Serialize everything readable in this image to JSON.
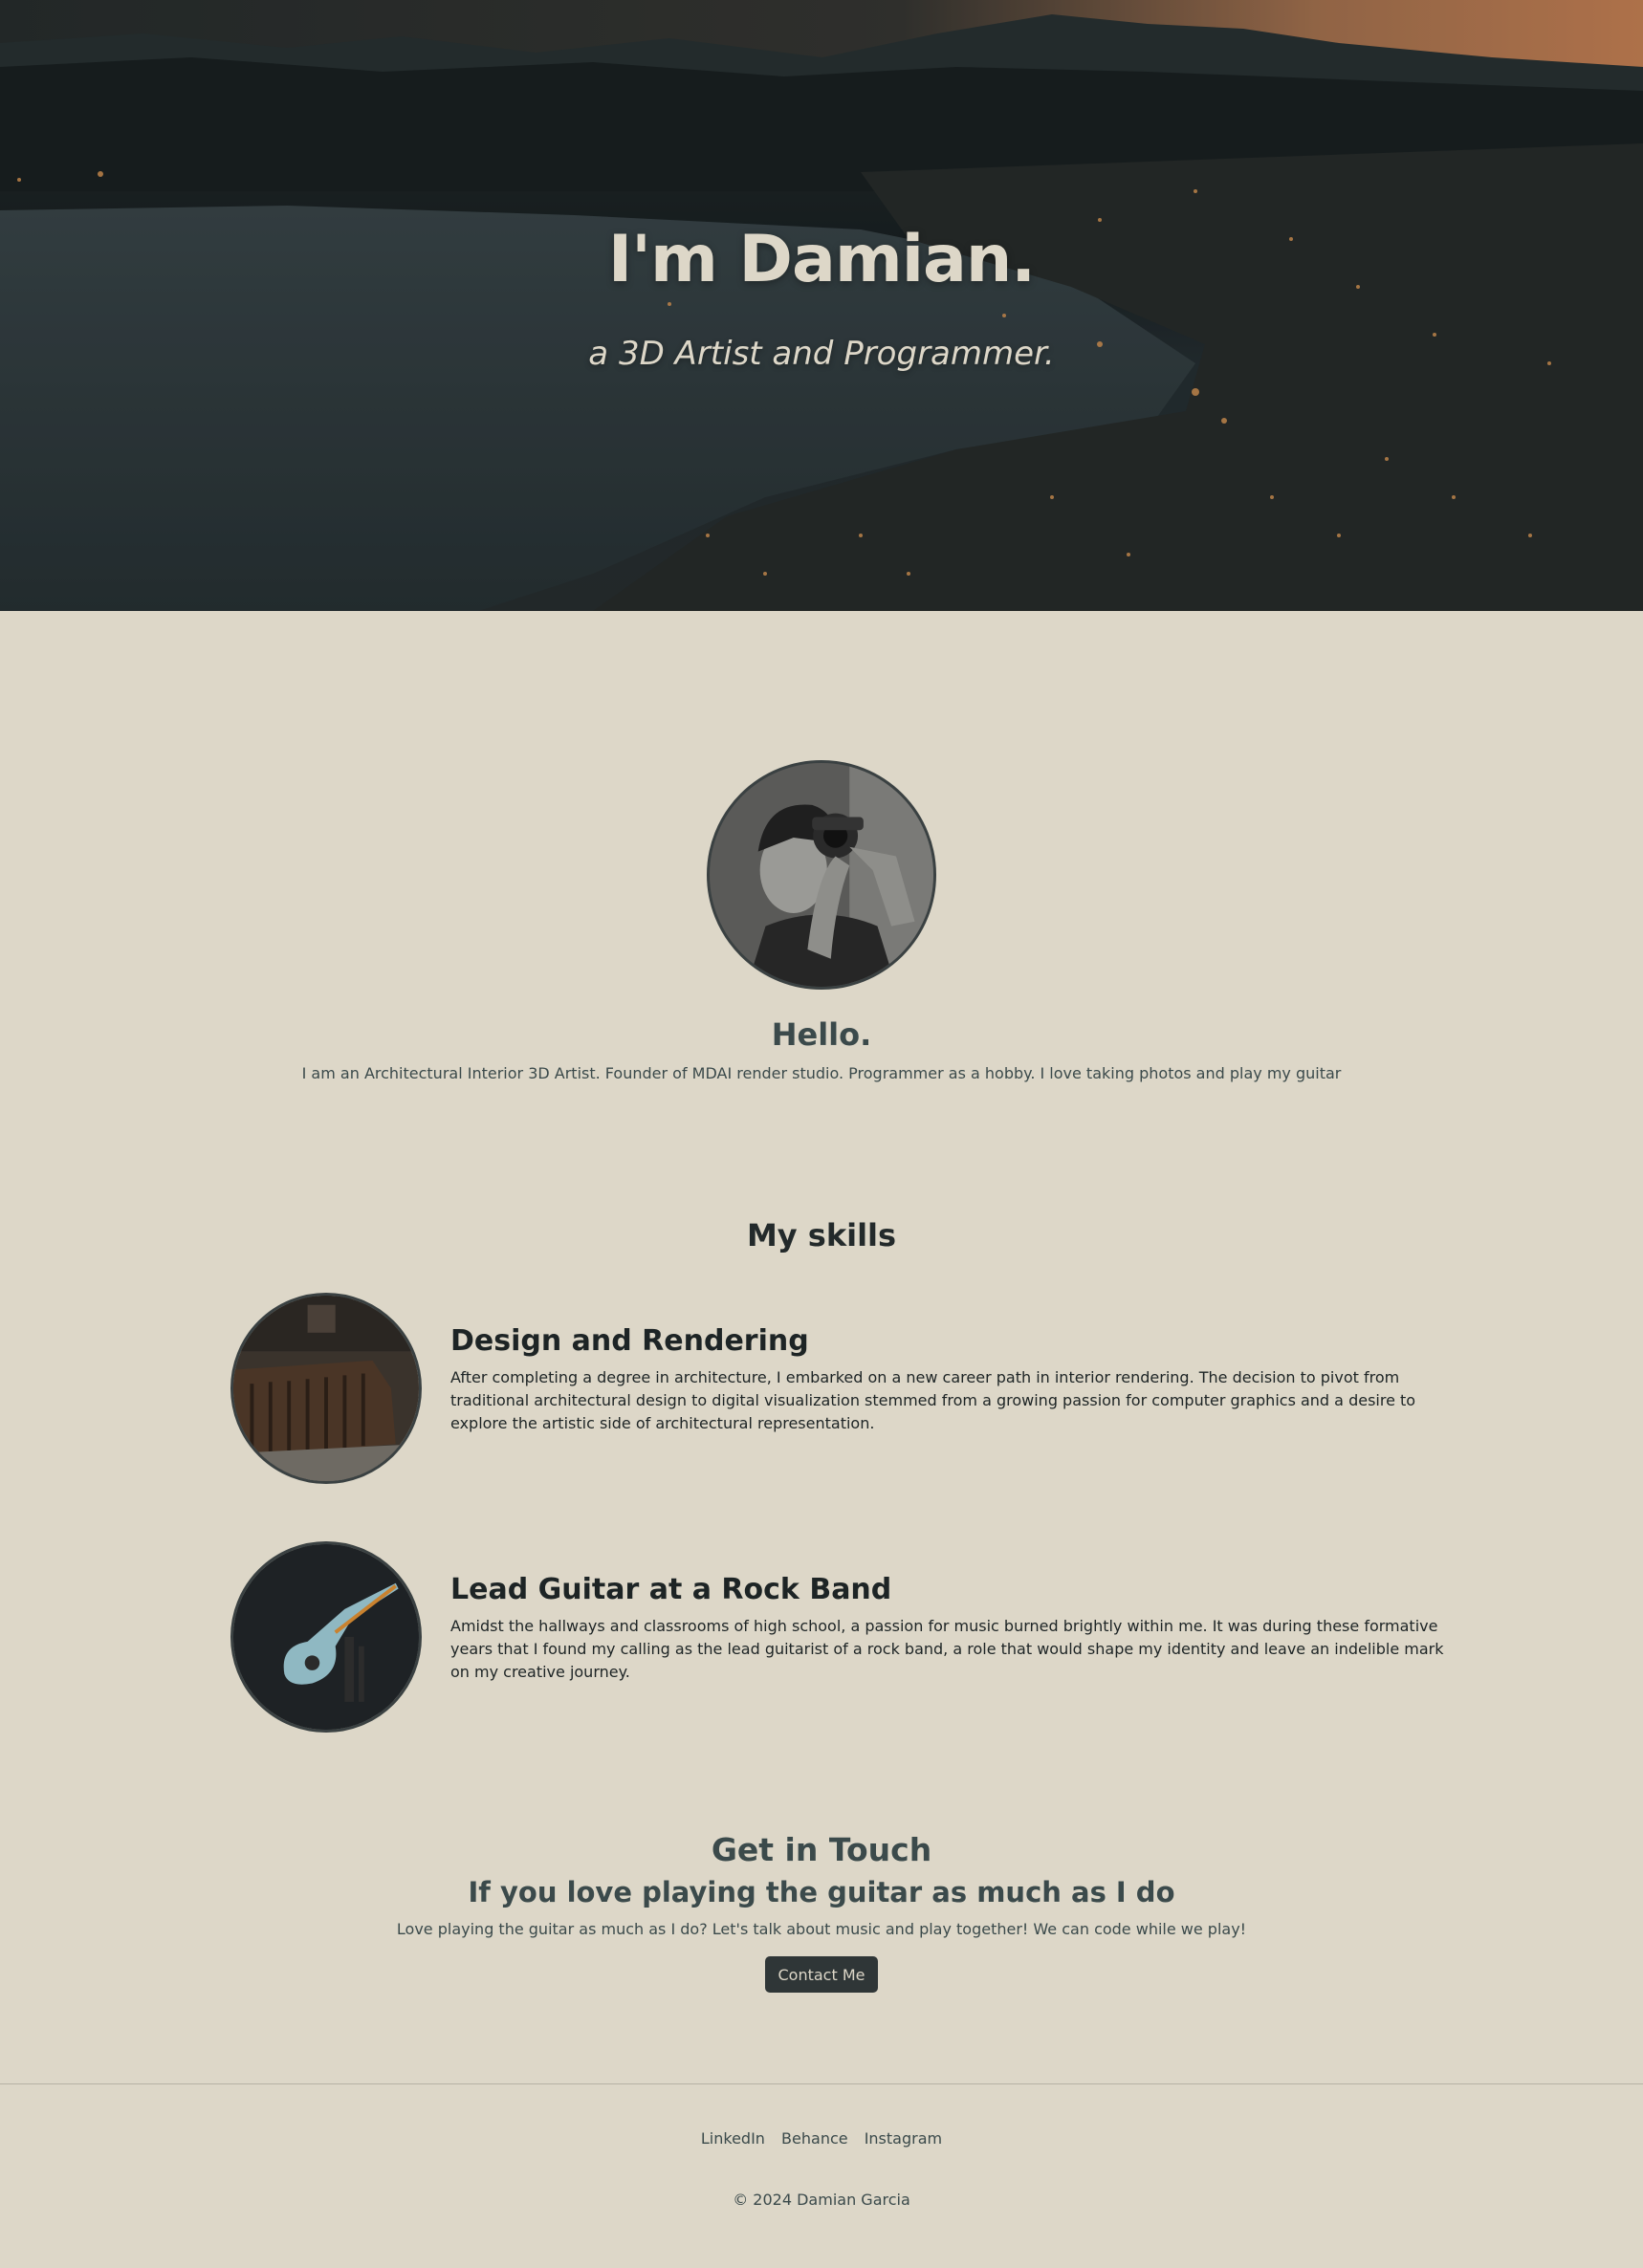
{
  "hero": {
    "title": "I'm Damian.",
    "subtitle": "a 3D Artist and Programmer."
  },
  "about": {
    "heading": "Hello.",
    "text": "I am an Architectural Interior 3D Artist. Founder of MDAI render studio. Programmer as a hobby. I love taking photos and play my guitar"
  },
  "skills": {
    "heading": "My skills",
    "items": [
      {
        "title": "Design and Rendering",
        "text": "After completing a degree in architecture, I embarked on a new career path in interior rendering. The decision to pivot from traditional architectural design to digital visualization stemmed from a growing passion for computer graphics and a desire to explore the artistic side of architectural representation."
      },
      {
        "title": "Lead Guitar at a Rock Band",
        "text": "Amidst the hallways and classrooms of high school, a passion for music burned brightly within me. It was during these formative years that I found my calling as the lead guitarist of a rock band, a role that would shape my identity and leave an indelible mark on my creative journey."
      }
    ]
  },
  "contact": {
    "heading": "Get in Touch",
    "subheading": "If you love playing the guitar as much as I do",
    "text": "Love playing the guitar as much as I do? Let's talk about music and play together! We can code while we play!",
    "button_label": "Contact Me"
  },
  "footer": {
    "links": [
      "LinkedIn",
      "Behance",
      "Instagram"
    ],
    "copyright": "© 2024 Damian Garcia"
  },
  "colors": {
    "background": "#ddd7c8",
    "text_dark": "#1d2425",
    "text_muted": "#3b4a4b",
    "button": "#2f3637"
  }
}
